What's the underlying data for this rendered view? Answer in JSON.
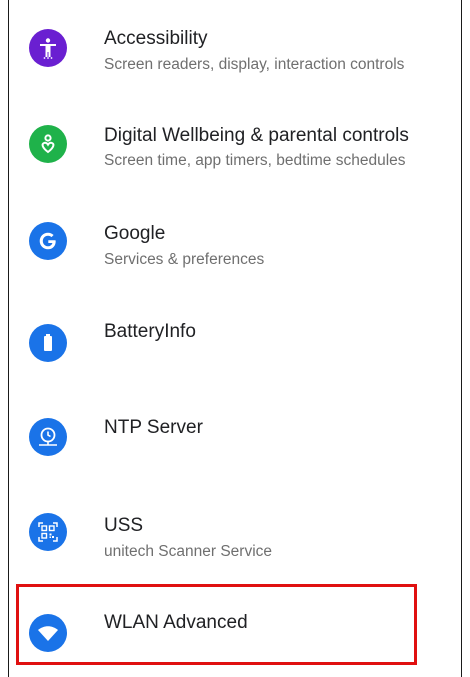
{
  "settings": {
    "items": [
      {
        "title": "Accessibility",
        "subtitle": "Screen readers, display, interaction controls",
        "icon": "accessibility-icon",
        "color": "#6a1fd1"
      },
      {
        "title": "Digital Wellbeing & parental controls",
        "subtitle": "Screen time, app timers, bedtime schedules",
        "icon": "wellbeing-icon",
        "color": "#1fb24a"
      },
      {
        "title": "Google",
        "subtitle": "Services & preferences",
        "icon": "google-icon",
        "color": "#1a73e8"
      },
      {
        "title": "BatteryInfo",
        "subtitle": "",
        "icon": "battery-icon",
        "color": "#1a73e8"
      },
      {
        "title": "NTP Server",
        "subtitle": "",
        "icon": "ntp-clock-icon",
        "color": "#1a73e8"
      },
      {
        "title": "USS",
        "subtitle": "unitech Scanner Service",
        "icon": "qr-scanner-icon",
        "color": "#1a73e8"
      },
      {
        "title": "WLAN Advanced",
        "subtitle": "",
        "icon": "wifi-icon",
        "color": "#1a73e8"
      }
    ],
    "highlight_color": "#e01010"
  }
}
